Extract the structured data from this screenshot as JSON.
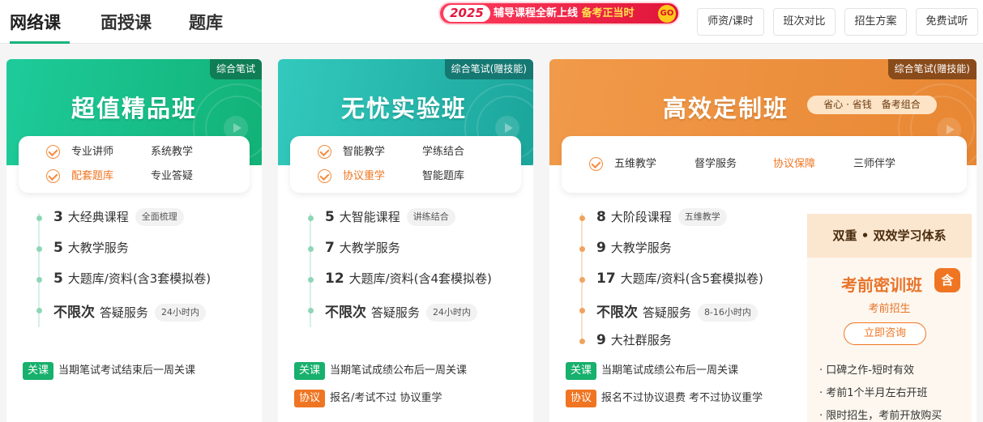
{
  "tabs": [
    {
      "label": "网络课",
      "active": true
    },
    {
      "label": "面授课",
      "active": false
    },
    {
      "label": "题库",
      "active": false
    }
  ],
  "promo": {
    "year": "2025",
    "text_a": "辅导课程全新上线",
    "text_b": "备考正当时",
    "go": "GO"
  },
  "header_buttons": [
    "师资/课时",
    "班次对比",
    "招生方案",
    "免费试听"
  ],
  "cards": [
    {
      "corner": "综合笔试",
      "title": "超值精品班",
      "features": [
        {
          "label": "专业讲师",
          "highlight": false
        },
        {
          "label": "系统教学",
          "highlight": false
        },
        {
          "label": "配套题库",
          "highlight": true
        },
        {
          "label": "专业答疑",
          "highlight": false
        }
      ],
      "list": [
        {
          "num": "3",
          "text": "大经典课程",
          "tag": "全面梳理"
        },
        {
          "num": "5",
          "text": "大教学服务",
          "tag": ""
        },
        {
          "num": "5",
          "text": "大题库/资料(含3套模拟卷)",
          "tag": ""
        },
        {
          "num": "不限次",
          "text": "答疑服务",
          "tag": "24小时内"
        }
      ],
      "notes": [
        {
          "badge": "关课",
          "text": "当期笔试考试结束后一周关课"
        }
      ]
    },
    {
      "corner": "综合笔试(赠技能)",
      "title": "无忧实验班",
      "features": [
        {
          "label": "智能教学",
          "highlight": false
        },
        {
          "label": "学练结合",
          "highlight": false
        },
        {
          "label": "协议重学",
          "highlight": true
        },
        {
          "label": "智能题库",
          "highlight": false
        }
      ],
      "list": [
        {
          "num": "5",
          "text": "大智能课程",
          "tag": "讲练结合"
        },
        {
          "num": "7",
          "text": "大教学服务",
          "tag": ""
        },
        {
          "num": "12",
          "text": "大题库/资料(含4套模拟卷)",
          "tag": ""
        },
        {
          "num": "不限次",
          "text": "答疑服务",
          "tag": "24小时内"
        }
      ],
      "notes": [
        {
          "badge": "关课",
          "text": "当期笔试成绩公布后一周关课"
        },
        {
          "badge": "协议",
          "text": "报名/考试不过 协议重学"
        }
      ]
    },
    {
      "corner": "综合笔试(赠技能)",
      "title": "高效定制班",
      "pill": "省心 · 省钱　备考组合",
      "features": [
        {
          "label": "五维教学",
          "highlight": false
        },
        {
          "label": "督学服务",
          "highlight": false
        },
        {
          "label": "协议保障",
          "highlight": true
        },
        {
          "label": "三师伴学",
          "highlight": false
        }
      ],
      "list": [
        {
          "num": "8",
          "text": "大阶段课程",
          "tag": "五维教学"
        },
        {
          "num": "9",
          "text": "大教学服务",
          "tag": ""
        },
        {
          "num": "17",
          "text": "大题库/资料(含5套模拟卷)",
          "tag": ""
        },
        {
          "num": "不限次",
          "text": "答疑服务",
          "tag": "8-16小时内"
        },
        {
          "num": "9",
          "text": "大社群服务",
          "tag": ""
        }
      ],
      "notes": [
        {
          "badge": "关课",
          "text": "当期笔试成绩公布后一周关课"
        },
        {
          "badge": "协议",
          "text": "报名不过协议退费 考不过协议重学"
        }
      ],
      "panel": {
        "head": "双重 • 双效学习体系",
        "title": "考前密训班",
        "badge": "含",
        "sub": "考前招生",
        "button": "立即咨询",
        "bullets": [
          "· 口碑之作-短时有效",
          "· 考前1个半月左右开班",
          "· 限时招生，考前开放购买"
        ]
      }
    }
  ],
  "colors": {
    "green": "#16b37a",
    "teal": "#21aba0",
    "orange": "#f07522"
  }
}
